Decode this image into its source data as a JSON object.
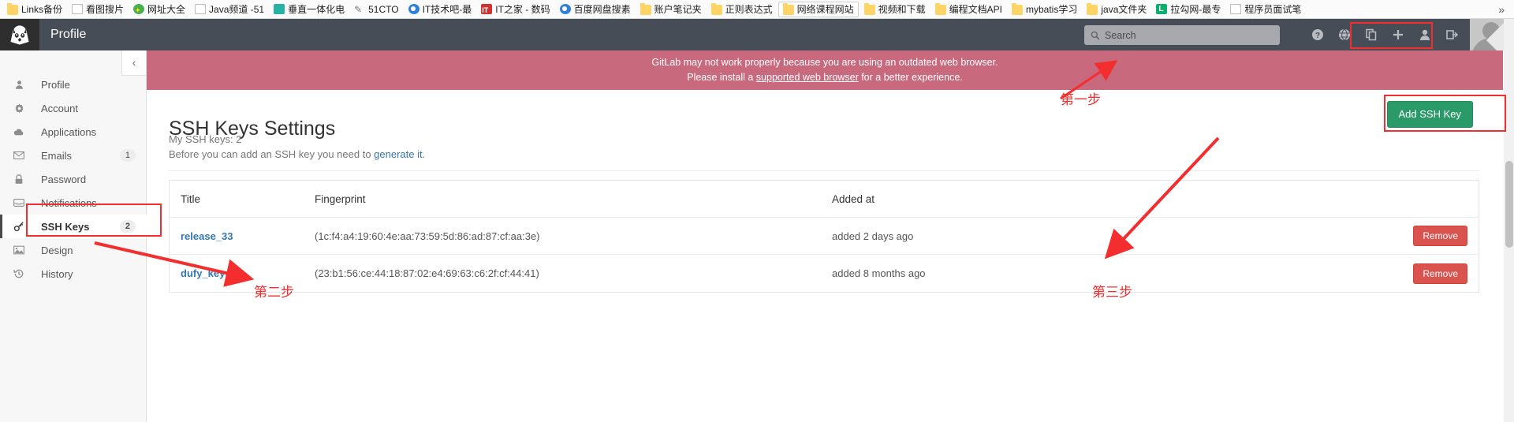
{
  "browser": {
    "bookmarks": [
      {
        "label": "Links备份",
        "icon": "folder-icon",
        "boxed": false
      },
      {
        "label": "看图搜片",
        "icon": "page-icon",
        "boxed": false
      },
      {
        "label": "网址大全",
        "icon": "green-circle-icon",
        "boxed": false
      },
      {
        "label": "Java频道 -51",
        "icon": "page-icon",
        "boxed": false
      },
      {
        "label": "垂直一体化电",
        "icon": "teal-icon",
        "boxed": false
      },
      {
        "label": "51CTO",
        "icon": "pen-icon",
        "boxed": false
      },
      {
        "label": "IT技术吧-最",
        "icon": "blue-circle-icon",
        "boxed": false
      },
      {
        "label": "IT之家 - 数码",
        "icon": "red-it-icon",
        "boxed": false
      },
      {
        "label": "百度网盘搜素",
        "icon": "baidu-icon",
        "boxed": false
      },
      {
        "label": "账户笔记夹",
        "icon": "folder-icon",
        "boxed": false
      },
      {
        "label": "正则表达式",
        "icon": "folder-icon",
        "boxed": false
      },
      {
        "label": "网络课程网站",
        "icon": "folder-icon",
        "boxed": true
      },
      {
        "label": "视频和下载",
        "icon": "folder-icon",
        "boxed": false
      },
      {
        "label": "编程文档API",
        "icon": "folder-icon",
        "boxed": false
      },
      {
        "label": "mybatis学习",
        "icon": "folder-icon",
        "boxed": false
      },
      {
        "label": "java文件夹",
        "icon": "folder-icon",
        "boxed": false
      },
      {
        "label": "拉勾网-最专",
        "icon": "lagou-icon",
        "boxed": false
      },
      {
        "label": "程序员面试笔",
        "icon": "page-icon",
        "boxed": false
      }
    ],
    "overflow_label": "»"
  },
  "header": {
    "logo_name": "gitlab-fox-logo",
    "title": "Profile",
    "search": {
      "placeholder": "Search",
      "value": ""
    },
    "icons": [
      {
        "name": "help-icon",
        "glyph": "?"
      },
      {
        "name": "globe-icon",
        "glyph": "◉"
      },
      {
        "name": "copy-icon",
        "glyph": "❐"
      },
      {
        "name": "plus-icon",
        "glyph": "＋"
      },
      {
        "name": "user-icon",
        "glyph": "👤"
      },
      {
        "name": "signout-icon",
        "glyph": "⇥"
      }
    ]
  },
  "alert": {
    "line1": "GitLab may not work properly because you are using an outdated web browser.",
    "line2_before": "Please install a ",
    "link": "supported web browser",
    "line2_after": " for a better experience.",
    "color": "#c9697e"
  },
  "sidebar": {
    "collapse_icon": "chevron-left-icon",
    "items": [
      {
        "label": "Profile",
        "icon": "user-icon",
        "count": "",
        "active": false
      },
      {
        "label": "Account",
        "icon": "gear-icon",
        "count": "",
        "active": false
      },
      {
        "label": "Applications",
        "icon": "cloud-icon",
        "count": "",
        "active": false
      },
      {
        "label": "Emails",
        "icon": "envelope-icon",
        "count": "1",
        "active": false
      },
      {
        "label": "Password",
        "icon": "lock-icon",
        "count": "",
        "active": false
      },
      {
        "label": "Notifications",
        "icon": "inbox-icon",
        "count": "",
        "active": false
      },
      {
        "label": "SSH Keys",
        "icon": "key-icon",
        "count": "2",
        "active": true
      },
      {
        "label": "Design",
        "icon": "image-icon",
        "count": "",
        "active": false
      },
      {
        "label": "History",
        "icon": "history-icon",
        "count": "",
        "active": false
      }
    ]
  },
  "main": {
    "page_title": "SSH Keys Settings",
    "my_keys_text": "My SSH keys: 2",
    "before_text": "Before you can add an SSH key you need to ",
    "generate_link": "generate it",
    "after_text": ".",
    "add_button": "Add SSH Key",
    "add_button_color": "#2b9a69",
    "table": {
      "columns": [
        "Title",
        "Fingerprint",
        "Added at",
        ""
      ],
      "rows": [
        {
          "title": "release_33",
          "fingerprint": "(1c:f4:a4:19:60:4e:aa:73:59:5d:86:ad:87:cf:aa:3e)",
          "added_at": "added 2 days ago",
          "action": "Remove"
        },
        {
          "title": "dufy_key",
          "fingerprint": "(23:b1:56:ce:44:18:87:02:e4:69:63:c6:2f:cf:44:41)",
          "added_at": "added 8 months ago",
          "action": "Remove"
        }
      ]
    }
  },
  "annotations": {
    "color": "#f42e2e",
    "step1": "第一步",
    "step2": "第二步",
    "step3": "第三步"
  }
}
